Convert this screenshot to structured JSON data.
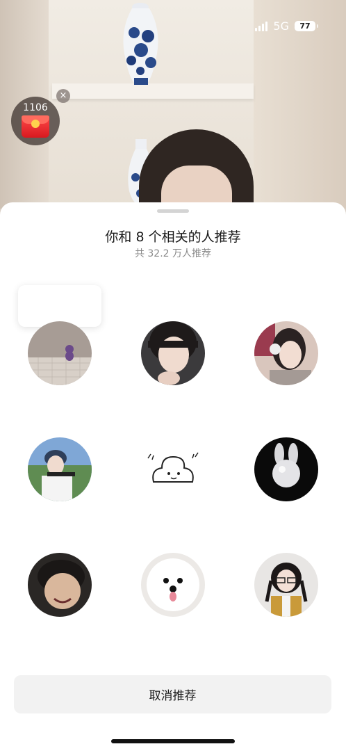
{
  "status_bar": {
    "network": "5G",
    "battery": "77"
  },
  "red_packet": {
    "count": "1106",
    "close_symbol": "×"
  },
  "sheet": {
    "title": "你和 8 个相关的人推荐",
    "subtitle": "共 32.2 万人推荐",
    "cancel_label": "取消推荐"
  },
  "colors": {
    "sheet_bg": "#ffffff",
    "cancel_bg": "#f2f2f2",
    "title_text": "#1a1a1a",
    "subtitle_text": "#8a8a8a"
  }
}
